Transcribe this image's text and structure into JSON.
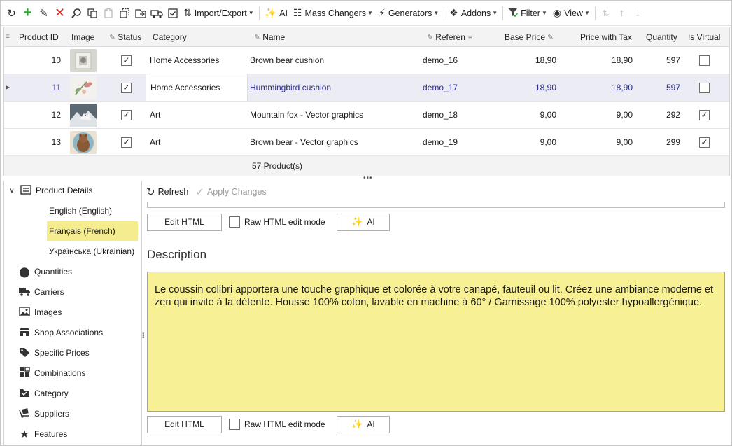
{
  "toolbar": {
    "items": [
      {
        "label": "Import/Export"
      },
      {
        "label": "AI"
      },
      {
        "label": "Mass Changers"
      },
      {
        "label": "Generators"
      },
      {
        "label": "Addons"
      },
      {
        "label": "Filter"
      },
      {
        "label": "View"
      }
    ]
  },
  "grid": {
    "columns": [
      "Product ID",
      "Image",
      "Status",
      "Category",
      "Name",
      "Referen",
      "Base Price",
      "Price with Tax",
      "Quantity",
      "Is Virtual"
    ],
    "rows": [
      {
        "id": "10",
        "category": "Home Accessories",
        "name": "Brown bear cushion",
        "reference": "demo_16",
        "base_price": "18,90",
        "price_tax": "18,90",
        "quantity": "597",
        "status": true,
        "virtual": false
      },
      {
        "id": "11",
        "category": "Home Accessories",
        "name": "Hummingbird cushion",
        "reference": "demo_17",
        "base_price": "18,90",
        "price_tax": "18,90",
        "quantity": "597",
        "status": true,
        "virtual": false
      },
      {
        "id": "12",
        "category": "Art",
        "name": "Mountain fox - Vector graphics",
        "reference": "demo_18",
        "base_price": "9,00",
        "price_tax": "9,00",
        "quantity": "292",
        "status": true,
        "virtual": true
      },
      {
        "id": "13",
        "category": "Art",
        "name": "Brown bear - Vector graphics",
        "reference": "demo_19",
        "base_price": "9,00",
        "price_tax": "9,00",
        "quantity": "299",
        "status": true,
        "virtual": true
      }
    ],
    "footer": "57 Product(s)"
  },
  "tree": {
    "root": "Product Details",
    "languages": [
      "English (English)",
      "Français (French)",
      "Українська (Ukrainian)"
    ],
    "items": [
      "Quantities",
      "Carriers",
      "Images",
      "Shop Associations",
      "Specific Prices",
      "Combinations",
      "Category",
      "Suppliers",
      "Features"
    ]
  },
  "panel": {
    "refresh": "Refresh",
    "apply": "Apply Changes",
    "edit_html": "Edit HTML",
    "raw_mode": "Raw HTML edit mode",
    "ai": "AI",
    "section_title": "Description",
    "description": "Le coussin colibri apportera une touche graphique et colorée à votre canapé, fauteuil ou lit. Créez une ambiance moderne et zen qui invite à la détente. Housse 100% coton, lavable en machine à 60° / Garnissage 100% polyester hypoallergénique."
  },
  "colors": {
    "selected_row": "#ececf4",
    "selected_text": "#2c2c8c",
    "active_language": "#f4ec8e",
    "description_bg": "#f8f094"
  }
}
